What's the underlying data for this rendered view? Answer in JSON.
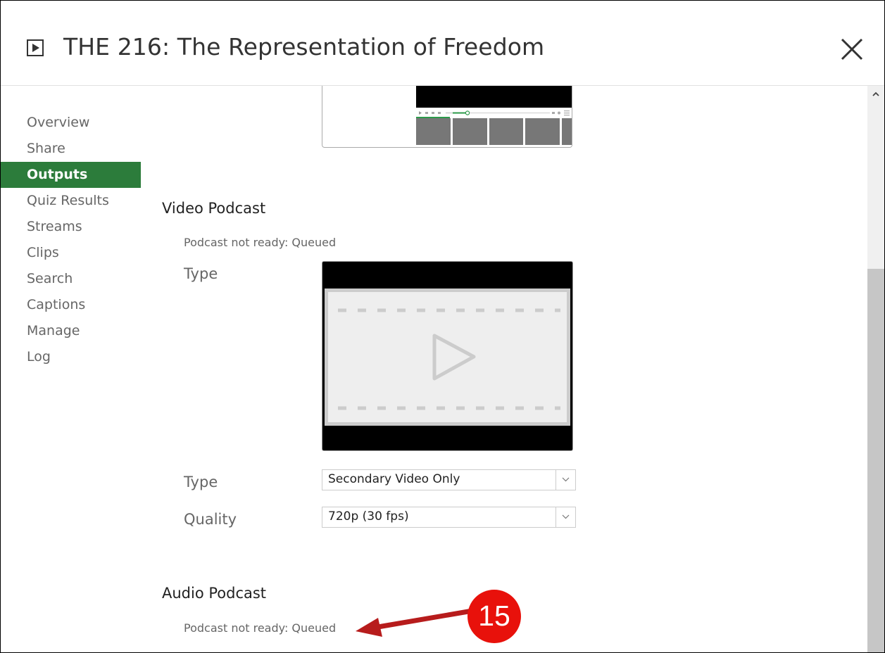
{
  "header": {
    "title": "THE 216: The Representation of Freedom"
  },
  "sidebar": {
    "items": [
      {
        "label": "Overview",
        "active": false
      },
      {
        "label": "Share",
        "active": false
      },
      {
        "label": "Outputs",
        "active": true
      },
      {
        "label": "Quiz Results",
        "active": false
      },
      {
        "label": "Streams",
        "active": false
      },
      {
        "label": "Clips",
        "active": false
      },
      {
        "label": "Search",
        "active": false
      },
      {
        "label": "Captions",
        "active": false
      },
      {
        "label": "Manage",
        "active": false
      },
      {
        "label": "Log",
        "active": false
      }
    ]
  },
  "video_podcast": {
    "title": "Video Podcast",
    "status": "Podcast not ready: Queued",
    "type_label": "Type",
    "type_select_label": "Type",
    "type_value": "Secondary Video Only",
    "quality_label": "Quality",
    "quality_value": "720p (30 fps)"
  },
  "audio_podcast": {
    "title": "Audio Podcast",
    "status": "Podcast not ready: Queued"
  },
  "annotation": {
    "badge_number": "15"
  },
  "colors": {
    "accent": "#2c7c3b",
    "badge": "#e8110b",
    "arrow": "#b71c1c"
  },
  "icons": {
    "title": "play-box-icon",
    "close": "close-icon",
    "scroll_up": "chevron-up-icon",
    "dropdown": "chevron-down-icon"
  }
}
